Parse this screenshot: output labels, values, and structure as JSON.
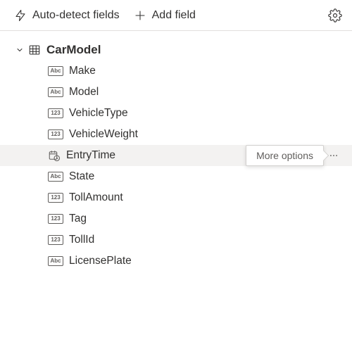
{
  "toolbar": {
    "autodetect_label": "Auto-detect fields",
    "addfield_label": "Add field"
  },
  "tooltip": {
    "more_options": "More options"
  },
  "tree": {
    "table": {
      "name": "CarModel",
      "expanded": true,
      "fields": [
        {
          "name": "Make",
          "type": "Abc",
          "highlighted": false
        },
        {
          "name": "Model",
          "type": "Abc",
          "highlighted": false
        },
        {
          "name": "VehicleType",
          "type": "123",
          "highlighted": false
        },
        {
          "name": "VehicleWeight",
          "type": "123",
          "highlighted": false
        },
        {
          "name": "EntryTime",
          "type": "datetime",
          "highlighted": true
        },
        {
          "name": "State",
          "type": "Abc",
          "highlighted": false
        },
        {
          "name": "TollAmount",
          "type": "123",
          "highlighted": false
        },
        {
          "name": "Tag",
          "type": "123",
          "highlighted": false
        },
        {
          "name": "TollId",
          "type": "123",
          "highlighted": false
        },
        {
          "name": "LicensePlate",
          "type": "Abc",
          "highlighted": false
        }
      ]
    }
  }
}
